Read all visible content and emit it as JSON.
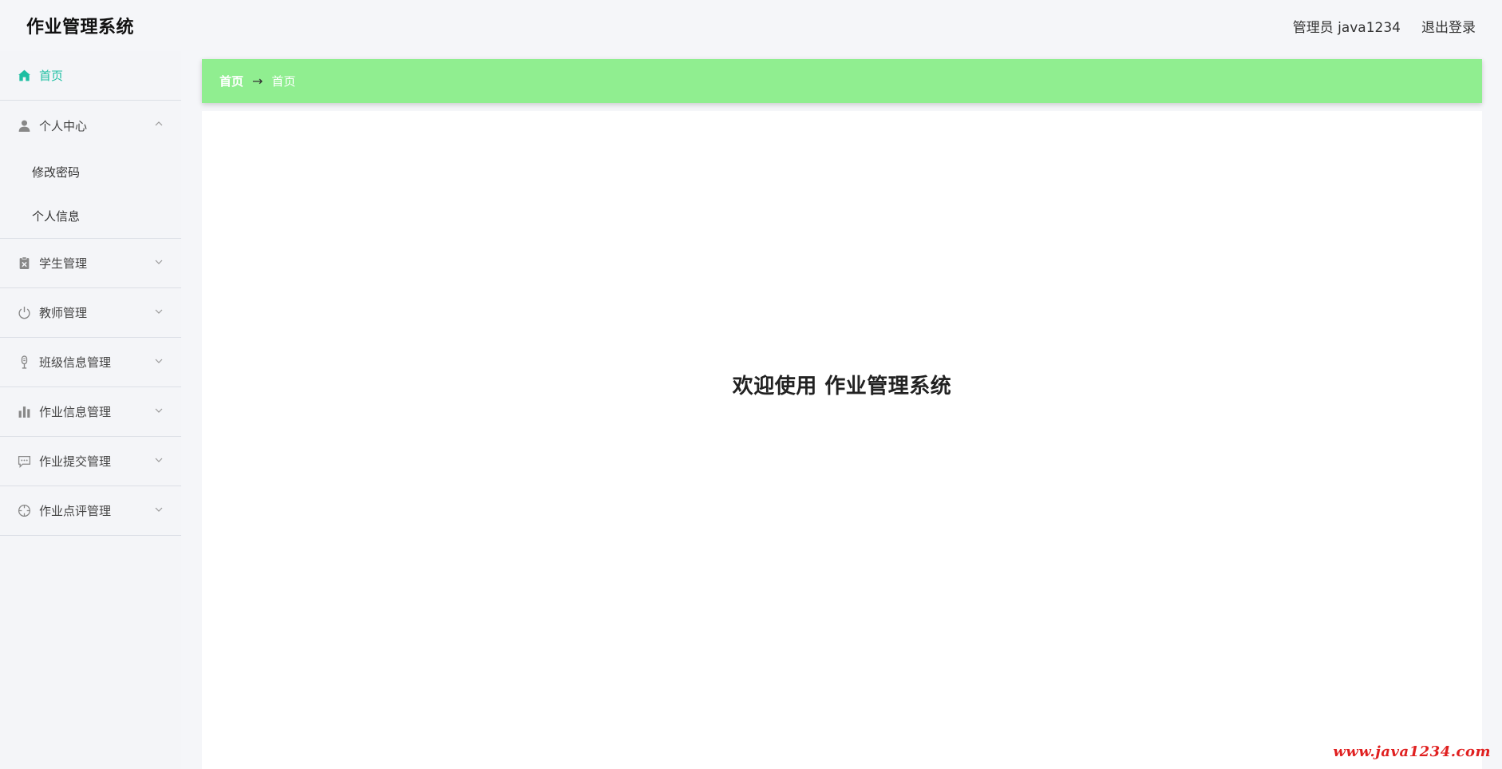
{
  "header": {
    "title": "作业管理系统",
    "user": "管理员 java1234",
    "logout": "退出登录"
  },
  "sidebar": {
    "home": {
      "label": "首页",
      "icon": "home-icon"
    },
    "items": [
      {
        "label": "个人中心",
        "icon": "user-icon",
        "expanded": true,
        "children": [
          "修改密码",
          "个人信息"
        ]
      },
      {
        "label": "学生管理",
        "icon": "clipboard-icon",
        "expanded": false
      },
      {
        "label": "教师管理",
        "icon": "power-icon",
        "expanded": false
      },
      {
        "label": "班级信息管理",
        "icon": "microphone-icon",
        "expanded": false
      },
      {
        "label": "作业信息管理",
        "icon": "bar-chart-icon",
        "expanded": false
      },
      {
        "label": "作业提交管理",
        "icon": "chat-icon",
        "expanded": false
      },
      {
        "label": "作业点评管理",
        "icon": "compass-icon",
        "expanded": false
      }
    ]
  },
  "breadcrumb": {
    "items": [
      "首页",
      "首页"
    ],
    "separator": "→"
  },
  "main": {
    "welcome": "欢迎使用 作业管理系统"
  },
  "watermark": "www.java1234.com",
  "colors": {
    "accent": "#1ebfa2",
    "breadcrumb_bg": "#90ee90",
    "watermark": "#e02020"
  }
}
